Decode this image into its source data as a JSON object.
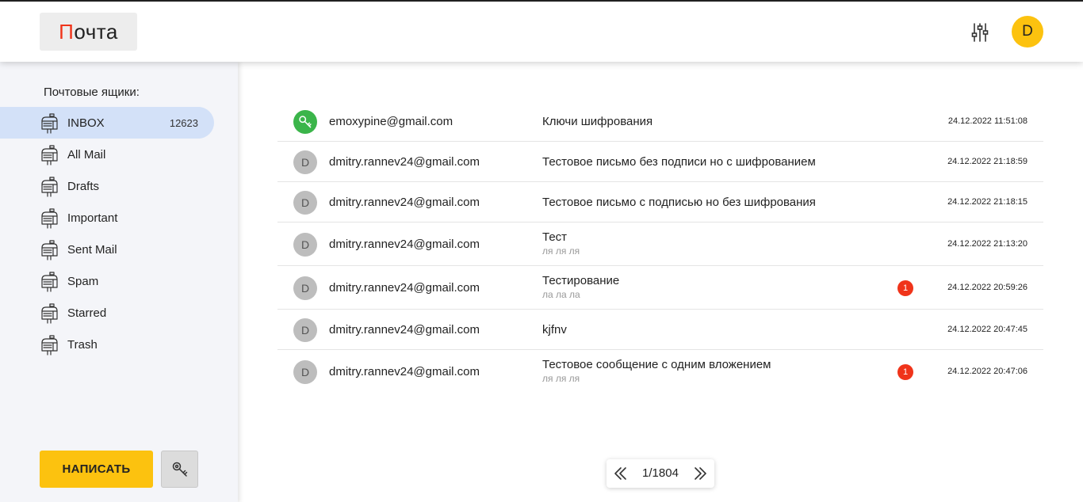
{
  "header": {
    "logo_first": "П",
    "logo_rest": "очта",
    "user_initial": "D",
    "accent_color": "#f0341a",
    "avatar_color": "#fcc20f"
  },
  "sidebar": {
    "title": "Почтовые ящики:",
    "mailboxes": [
      {
        "label": "INBOX",
        "count": "12623",
        "icon": "mailbox-icon"
      },
      {
        "label": "All Mail",
        "count": "",
        "icon": "mailbox-icon"
      },
      {
        "label": "Drafts",
        "count": "",
        "icon": "mailbox-icon"
      },
      {
        "label": "Important",
        "count": "",
        "icon": "mailbox-icon"
      },
      {
        "label": "Sent Mail",
        "count": "",
        "icon": "mailbox-icon"
      },
      {
        "label": "Spam",
        "count": "",
        "icon": "mailbox-icon"
      },
      {
        "label": "Starred",
        "count": "",
        "icon": "mailbox-icon"
      },
      {
        "label": "Trash",
        "count": "",
        "icon": "mailbox-icon"
      }
    ],
    "compose_label": "НАПИСАТЬ",
    "compose_color": "#fcc20f"
  },
  "messages": [
    {
      "avatar": "",
      "avatar_icon": "key-icon",
      "sender": "emoxypine@gmail.com",
      "subject": "Ключи шифрования",
      "preview": "",
      "attachments": "",
      "date": "24.12.2022 11:51:08"
    },
    {
      "avatar": "D",
      "sender": "dmitry.rannev24@gmail.com",
      "subject": "Тестовое письмо без подписи но с шифрованием",
      "preview": "",
      "attachments": "",
      "date": "24.12.2022 21:18:59"
    },
    {
      "avatar": "D",
      "sender": "dmitry.rannev24@gmail.com",
      "subject": "Тестовое письмо с подписью но без шифрования",
      "preview": "",
      "attachments": "",
      "date": "24.12.2022 21:18:15"
    },
    {
      "avatar": "D",
      "sender": "dmitry.rannev24@gmail.com",
      "subject": "Тест",
      "preview": "ля ля ля",
      "attachments": "",
      "date": "24.12.2022 21:13:20"
    },
    {
      "avatar": "D",
      "sender": "dmitry.rannev24@gmail.com",
      "subject": "Тестирование",
      "preview": "ла ла ла",
      "attachments": "1",
      "date": "24.12.2022 20:59:26"
    },
    {
      "avatar": "D",
      "sender": "dmitry.rannev24@gmail.com",
      "subject": "kjfnv",
      "preview": "",
      "attachments": "",
      "date": "24.12.2022 20:47:45"
    },
    {
      "avatar": "D",
      "sender": "dmitry.rannev24@gmail.com",
      "subject": "Тестовое сообщение с одним вложением",
      "preview": "ля ля ля",
      "attachments": "1",
      "date": "24.12.2022 20:47:06"
    }
  ],
  "pagination": {
    "page": "1/1804"
  }
}
